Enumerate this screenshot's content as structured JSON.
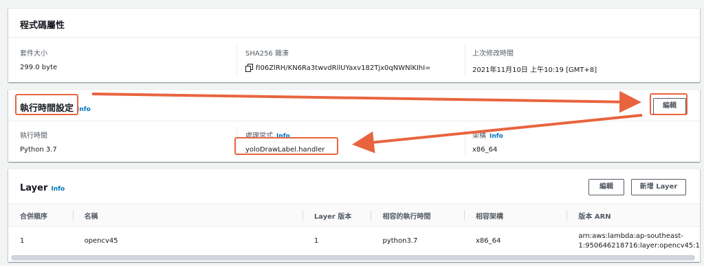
{
  "code_props": {
    "title": "程式碼屬性",
    "size_label": "套件大小",
    "size_value": "299.0 byte",
    "sha_label": "SHA256 雜湊",
    "sha_value": "fI06ZlRH/KN6Ra3twvdRllUYaxv182Tjx0qNWNlKIhI=",
    "modified_label": "上次修改時間",
    "modified_value": "2021年11月10日 上午10:19 [GMT+8]"
  },
  "runtime_settings": {
    "title": "執行時間設定",
    "info": "Info",
    "edit_label": "編輯",
    "runtime_label": "執行時間",
    "runtime_value": "Python 3.7",
    "handler_label": "處理常式",
    "handler_info": "Info",
    "handler_value": "yoloDrawLabel.handler",
    "arch_label": "架構",
    "arch_info": "Info",
    "arch_value": "x86_64"
  },
  "layer": {
    "title": "Layer",
    "info": "Info",
    "edit_label": "編輯",
    "add_label": "新增 Layer",
    "columns": [
      "合併順序",
      "名稱",
      "Layer 版本",
      "相容的執行時間",
      "相容架構",
      "版本 ARN"
    ],
    "rows": [
      {
        "order": "1",
        "name": "opencv45",
        "version": "1",
        "runtimes": "python3.7",
        "arch": "x86_64",
        "arn_line1": "arn:aws:lambda:ap-southeast-",
        "arn_line2": "1:950646218716:layer:opencv45:1"
      }
    ]
  },
  "colors": {
    "annotation": "#e8643f",
    "link": "#0073bb"
  }
}
